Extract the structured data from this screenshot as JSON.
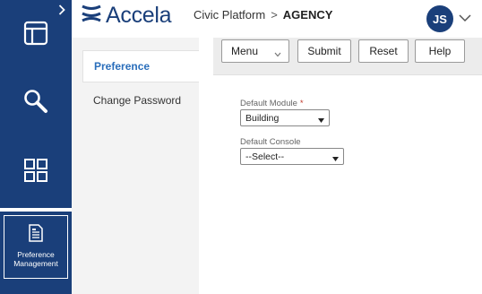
{
  "app": {
    "logo_text": "Accela",
    "breadcrumb": {
      "platform": "Civic Platform",
      "separator": ">",
      "agency": "AGENCY"
    },
    "user_initials": "JS",
    "brand_color": "#1a3f7a",
    "link_color": "#2a6ebb"
  },
  "rail": {
    "expand_icon": "chevron-right-icon",
    "items": [
      {
        "icon": "dashboard-icon"
      },
      {
        "icon": "search-icon"
      },
      {
        "icon": "apps-grid-icon"
      }
    ],
    "active_item": {
      "icon": "document-icon",
      "label_line1": "Preference",
      "label_line2": "Management"
    }
  },
  "nav": {
    "items": [
      {
        "label": "Preference",
        "active": true
      },
      {
        "label": "Change Password",
        "active": false
      }
    ]
  },
  "toolbar": {
    "menu_label": "Menu",
    "submit_label": "Submit",
    "reset_label": "Reset",
    "help_label": "Help"
  },
  "form": {
    "default_module": {
      "label": "Default Module",
      "required_marker": "*",
      "value": "Building"
    },
    "default_console": {
      "label": "Default Console",
      "value": "--Select--"
    }
  }
}
